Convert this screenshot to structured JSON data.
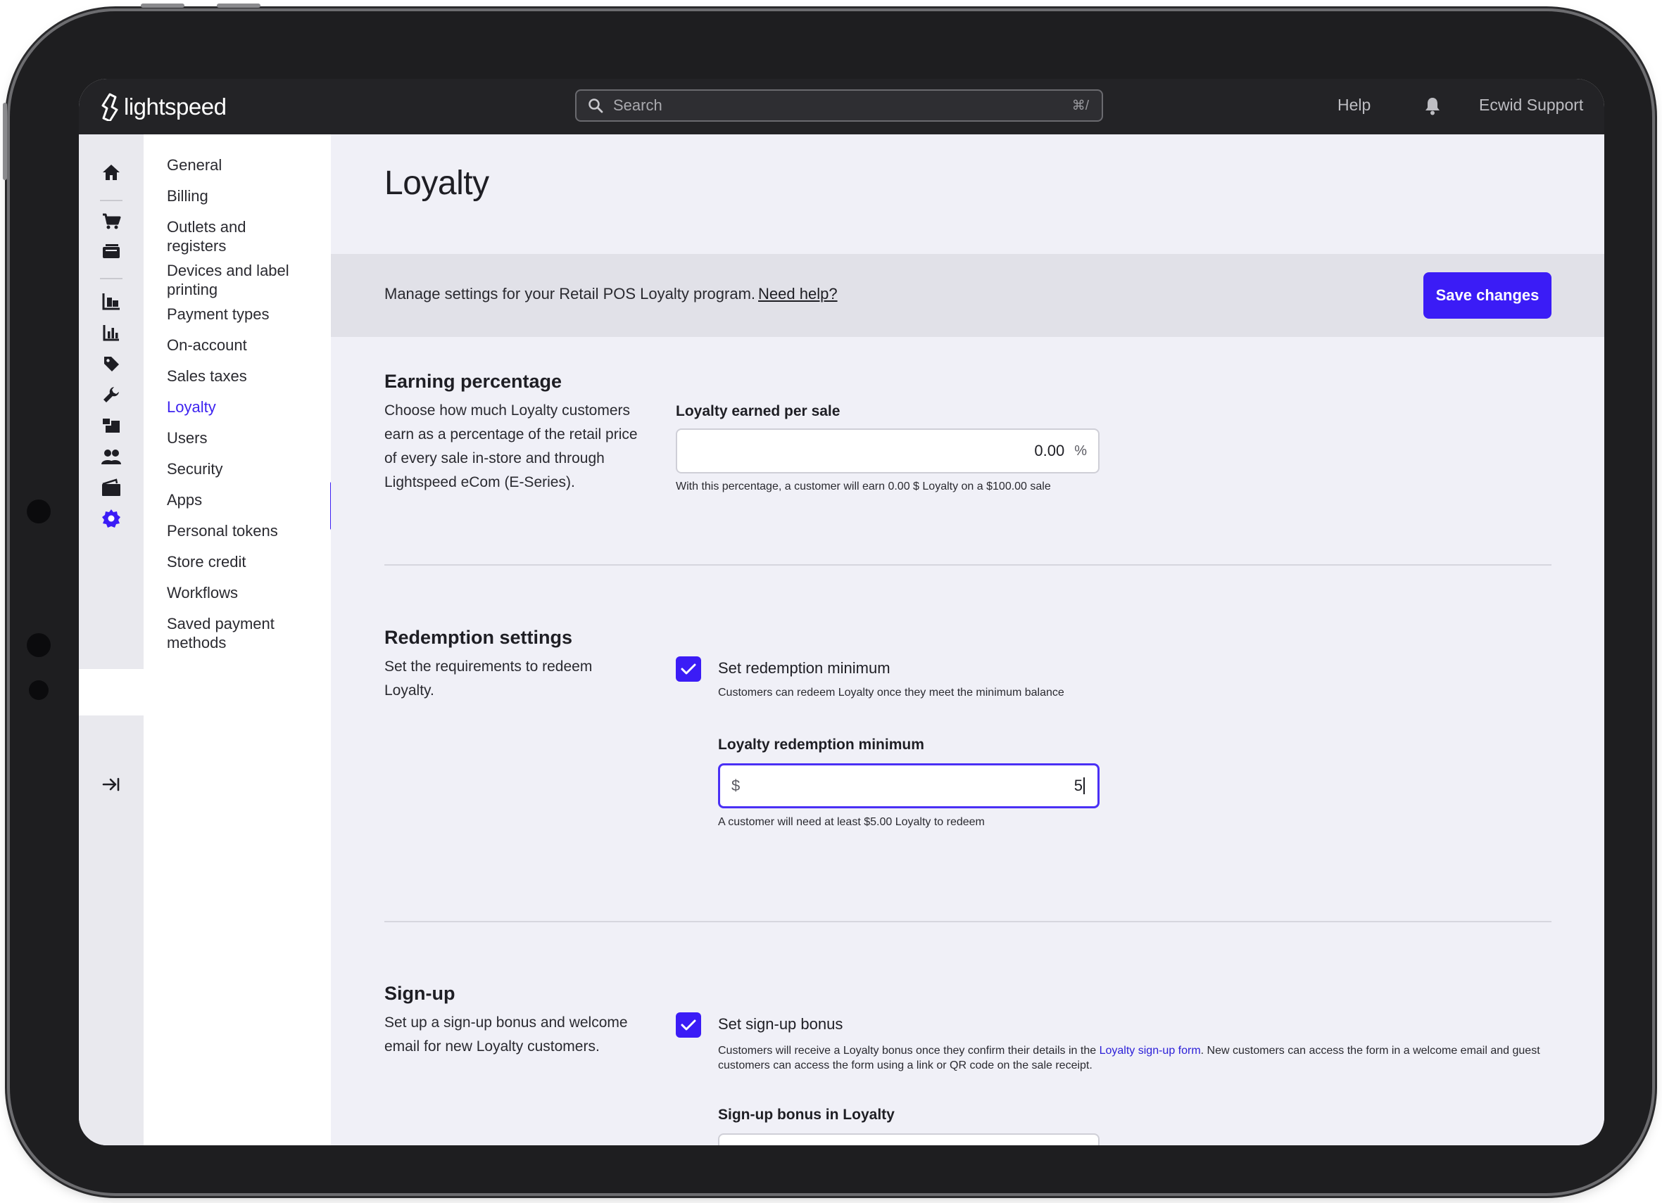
{
  "topbar": {
    "brand": "lightspeed",
    "search_placeholder": "Search",
    "search_shortcut": "⌘/",
    "help": "Help",
    "account": "Ecwid Support"
  },
  "rail": {
    "icons": [
      "home-icon",
      "cart-icon",
      "register-icon",
      "inventory-icon",
      "reports-icon",
      "tag-icon",
      "wrench-icon",
      "blocks-icon",
      "customers-icon",
      "wallet-icon",
      "settings-icon",
      "collapse-icon"
    ],
    "active": "settings-icon"
  },
  "nav": {
    "items": [
      {
        "label": "General"
      },
      {
        "label": "Billing"
      },
      {
        "label": "Outlets and registers"
      },
      {
        "label": "Devices and label printing"
      },
      {
        "label": "Payment types"
      },
      {
        "label": "On-account"
      },
      {
        "label": "Sales taxes"
      },
      {
        "label": "Loyalty"
      },
      {
        "label": "Users"
      },
      {
        "label": "Security"
      },
      {
        "label": "Apps"
      },
      {
        "label": "Personal tokens"
      },
      {
        "label": "Store credit"
      },
      {
        "label": "Workflows"
      },
      {
        "label": "Saved payment methods"
      }
    ],
    "active": "Loyalty"
  },
  "page": {
    "title": "Loyalty",
    "banner_text": "Manage settings for your Retail POS Loyalty program.",
    "banner_link": "Need help?",
    "save_label": "Save changes"
  },
  "earning": {
    "title": "Earning percentage",
    "desc": "Choose how much Loyalty customers earn as a percentage of the retail price of every sale in-store and through Lightspeed eCom (E-Series).",
    "field_label": "Loyalty earned per sale",
    "value": "0.00",
    "suffix": "%",
    "hint": "With this percentage, a customer will earn 0.00 $ Loyalty on a $100.00 sale"
  },
  "redemption": {
    "title": "Redemption settings",
    "desc": "Set the requirements to redeem Loyalty.",
    "checkbox_label": "Set redemption minimum",
    "checkbox_checked": true,
    "checkbox_hint": "Customers can redeem Loyalty once they meet the minimum balance",
    "field_label": "Loyalty redemption minimum",
    "prefix": "$",
    "value": "5",
    "hint": "A customer will need at least $5.00 Loyalty to redeem"
  },
  "signup": {
    "title": "Sign-up",
    "desc": "Set up a sign-up bonus and welcome email for new Loyalty customers.",
    "checkbox_label": "Set sign-up bonus",
    "checkbox_checked": true,
    "hint_pre": "Customers will receive a Loyalty bonus once they confirm their details in the",
    "hint_link": "Loyalty sign-up form",
    "hint_post": ". New customers can access the form in a welcome email and guest customers can access the form using a link or QR code on the sale receipt.",
    "field_label": "Sign-up bonus in Loyalty"
  },
  "colors": {
    "accent": "#3b1cf6",
    "topbar": "#232326",
    "main_bg": "#f0f0f7"
  }
}
